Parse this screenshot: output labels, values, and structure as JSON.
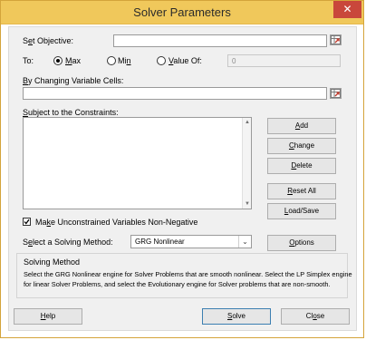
{
  "window": {
    "title": "Solver Parameters",
    "close_glyph": "✕"
  },
  "objective": {
    "label_pre": "S",
    "label_u": "e",
    "label_post": "t Objective:",
    "value": ""
  },
  "to": {
    "label": "To:",
    "max": {
      "pre": "",
      "u": "M",
      "post": "ax",
      "checked": true
    },
    "min": {
      "pre": "Mi",
      "u": "n",
      "post": "",
      "checked": false
    },
    "valueof": {
      "pre": "",
      "u": "V",
      "post": "alue Of:",
      "checked": false
    },
    "value_field": "0"
  },
  "changing": {
    "label_pre": "",
    "label_u": "B",
    "label_post": "y Changing Variable Cells:",
    "value": ""
  },
  "constraints": {
    "label_pre": "",
    "label_u": "S",
    "label_post": "ubject to the Constraints:",
    "items": []
  },
  "buttons": {
    "add": {
      "pre": "",
      "u": "A",
      "post": "dd"
    },
    "change": {
      "pre": "",
      "u": "C",
      "post": "hange"
    },
    "delete": {
      "pre": "",
      "u": "D",
      "post": "elete"
    },
    "reset": {
      "pre": "",
      "u": "R",
      "post": "eset All"
    },
    "loadsave": {
      "pre": "",
      "u": "L",
      "post": "oad/Save"
    },
    "options": {
      "pre": "",
      "u": "O",
      "post": "ptions"
    },
    "help": {
      "pre": "",
      "u": "H",
      "post": "elp"
    },
    "solve": {
      "pre": "",
      "u": "S",
      "post": "olve"
    },
    "close": {
      "pre": "Cl",
      "u": "o",
      "post": "se"
    }
  },
  "unconstrained": {
    "pre": "Ma",
    "u": "k",
    "post": "e Unconstrained Variables Non-Negative",
    "checked": true
  },
  "method": {
    "label_pre": "S",
    "label_u": "e",
    "label_post": "lect a Solving Method:",
    "selected": "GRG Nonlinear"
  },
  "solving_method": {
    "title": "Solving Method",
    "line1": "Select the GRG Nonlinear engine for Solver Problems that are smooth nonlinear. Select the LP Simplex engine",
    "line2": "for linear Solver Problems, and select the Evolutionary engine for Solver problems that are non-smooth."
  },
  "colors": {
    "titlebar": "#f0c85b",
    "close": "#c9473b",
    "accent": "#3c7fb1"
  }
}
